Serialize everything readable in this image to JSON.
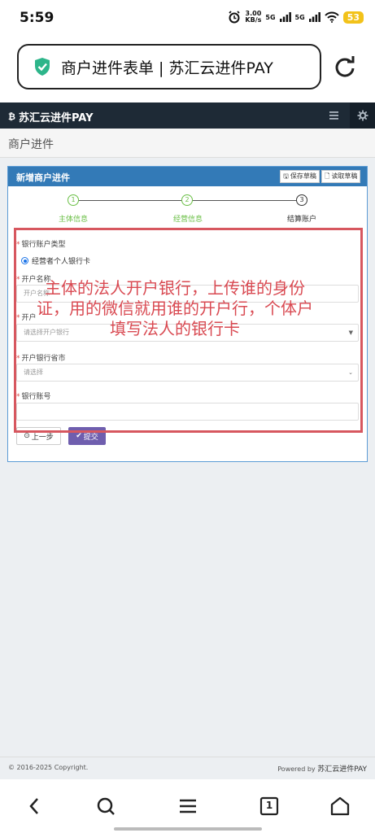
{
  "status": {
    "time": "5:59",
    "speed_value": "3.00",
    "speed_unit": "KB/s",
    "net1": "5G",
    "net2": "5G",
    "battery": "53"
  },
  "browser": {
    "page_title": "商户进件表单 | 苏汇云进件PAY"
  },
  "app": {
    "brand": "苏汇云进件PAY",
    "page_title": "商户进件"
  },
  "panel": {
    "title": "新增商户进件",
    "save_draft": "保存草稿",
    "load_draft": "读取草稿",
    "steps": [
      {
        "num": "1",
        "label": "主体信息"
      },
      {
        "num": "2",
        "label": "经营信息"
      },
      {
        "num": "3",
        "label": "结算账户"
      }
    ]
  },
  "form": {
    "account_type_label": "银行账户类型",
    "account_type_option": "经营者个人银行卡",
    "account_name_label": "开户名称",
    "account_name_placeholder": "开户名称",
    "bank_label": "开户",
    "bank_placeholder": "请选择开户银行",
    "province_label": "开户银行省市",
    "province_placeholder": "请选择",
    "account_no_label": "银行账号",
    "prev_button": "上一步",
    "submit_button": "提交"
  },
  "annotation": {
    "text": "主体的法人开户银行，上传谁的身份证，用的微信就用谁的开户行，个体户填写法人的银行卡"
  },
  "footer": {
    "copyright": "© 2016-2025 Copyright.",
    "powered_prefix": "Powered by",
    "powered_brand": "苏汇云进件PAY"
  },
  "colors": {
    "header_bg": "#1e2a36",
    "panel_head": "#337ab7",
    "step_done": "#6abf45",
    "submit_btn": "#6f5eae",
    "annotation": "#d7575f"
  },
  "bottom_nav": {
    "tab_count": "1"
  }
}
